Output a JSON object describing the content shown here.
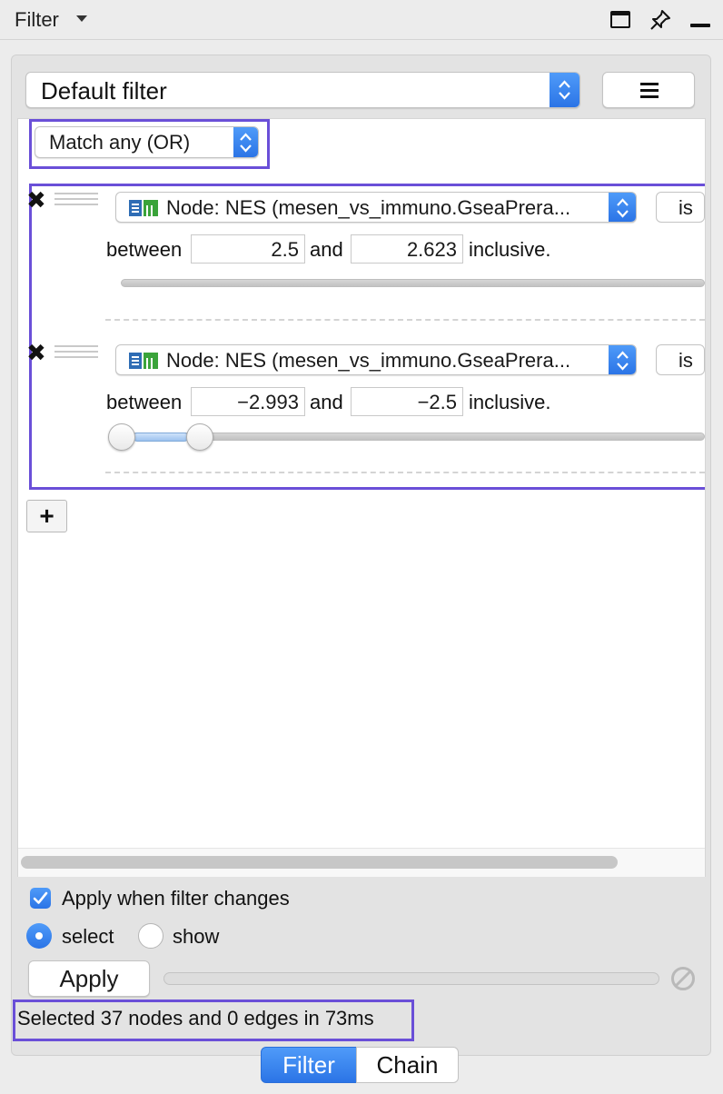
{
  "window": {
    "title": "Filter",
    "icons": [
      "chevron-down-icon",
      "window-icon",
      "pin-icon",
      "minimize-icon"
    ]
  },
  "filter_select": {
    "value": "Default filter"
  },
  "match_select": {
    "value": "Match any (OR)"
  },
  "filters": [
    {
      "column": "Node: NES (mesen_vs_immuno.GseaPrera...",
      "operator": "is",
      "between_label": "between",
      "min": "2.5",
      "and_label": "and",
      "max": "2.623",
      "inclusive_label": "inclusive.",
      "slider_low": 0.0,
      "slider_high": 1.0
    },
    {
      "column": "Node: NES (mesen_vs_immuno.GseaPrera...",
      "operator": "is",
      "between_label": "between",
      "min": "−2.993",
      "and_label": "and",
      "max": "−2.5",
      "inclusive_label": "inclusive.",
      "slider_low": 0.0,
      "slider_high": 0.15
    }
  ],
  "add_button": {
    "label": "+"
  },
  "options": {
    "apply_when_changes": {
      "label": "Apply when filter changes",
      "checked": true
    },
    "mode_select": {
      "label": "select",
      "selected": true
    },
    "mode_show": {
      "label": "show",
      "selected": false
    }
  },
  "apply_button": {
    "label": "Apply"
  },
  "status": {
    "text": "Selected 37 nodes and 0 edges in 73ms"
  },
  "tabs": [
    {
      "label": "Filter",
      "active": true
    },
    {
      "label": "Chain",
      "active": false
    }
  ],
  "colors": {
    "accent": "#2f7cf0",
    "highlight": "#6a4fd8",
    "column_icon_green": "#3aa33a",
    "column_icon_blue": "#2f6db5"
  }
}
